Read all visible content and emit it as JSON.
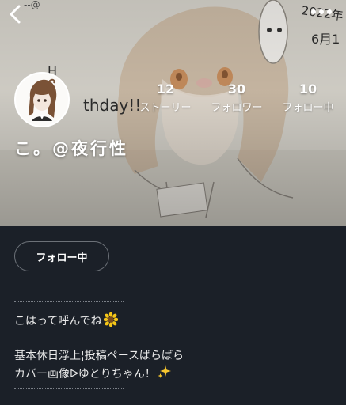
{
  "profile": {
    "username": "こ。@夜行性",
    "follow_button_label": "フォロー中"
  },
  "stats": [
    {
      "count": "12",
      "label": "ストーリー"
    },
    {
      "count": "30",
      "label": "フォロワー"
    },
    {
      "count": "10",
      "label": "フォロー中"
    }
  ],
  "bio": {
    "line1": "こはって呼んでね",
    "line2": "基本休日浮上¦投稿ペースばらばら",
    "line3": "カバー画像ᐅゆとりちゃん！"
  },
  "cover": {
    "handwriting_year": "2022年",
    "handwriting_date": "6月1",
    "handwriting_birthday": "thday!!"
  },
  "icons": {
    "back": "chevron-left-icon",
    "more": "more-horizontal-icon",
    "bio_emoji_1": "sunflower-icon",
    "bio_emoji_2": "sparkles-icon"
  },
  "colors": {
    "background": "#1b2028",
    "follow_button_border": "#6c7178",
    "divider": "#7b8088"
  }
}
